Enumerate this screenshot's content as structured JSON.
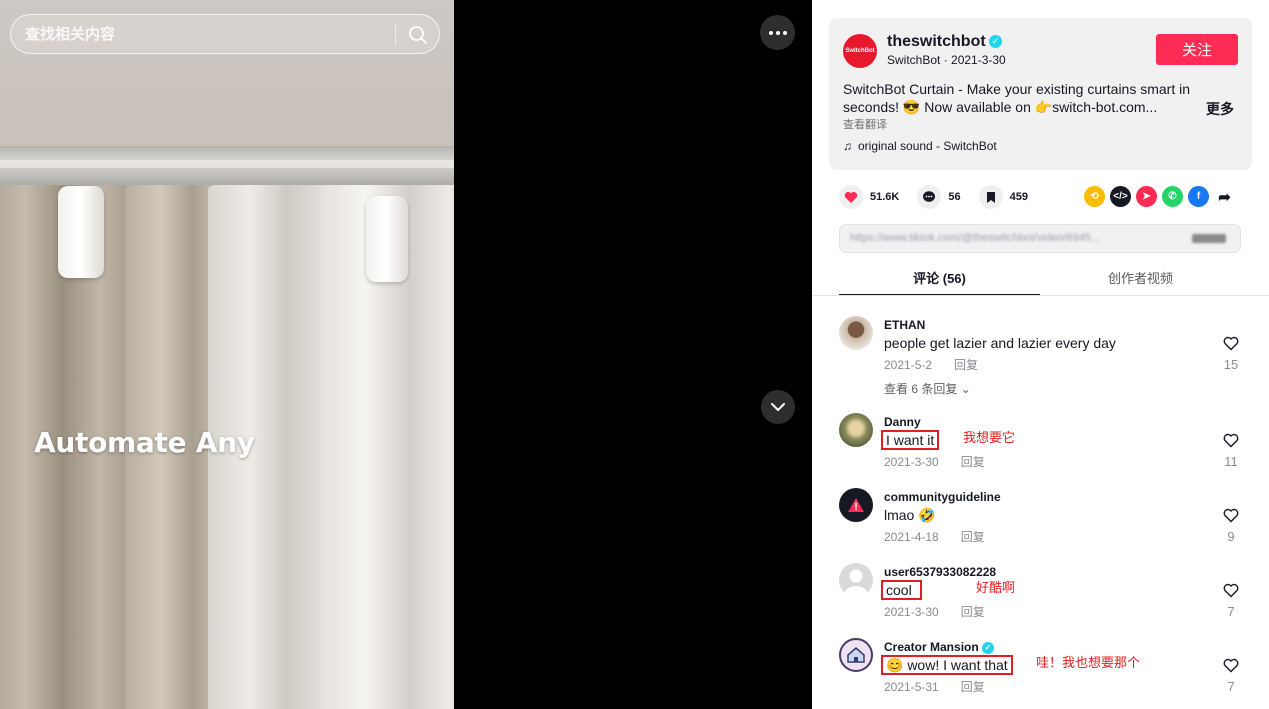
{
  "search": {
    "placeholder": "查找相关内容"
  },
  "video": {
    "overlay_text": "Automate Any"
  },
  "author": {
    "logo_text": "SwitchBot",
    "username": "theswitchbot",
    "nickname_date": "SwitchBot · 2021-3-30",
    "follow_label": "关注"
  },
  "description": {
    "text": "SwitchBot Curtain - Make your existing curtains smart in seconds! 😎 Now available on 👉switch-bot.com...",
    "more_label": "更多",
    "translate_label": "查看翻译",
    "sound": "original sound - SwitchBot"
  },
  "actions": {
    "likes": "51.6K",
    "comments": "56",
    "saves": "459"
  },
  "url_bar": {
    "text": "https://www.tiktok.com/@theswitchbot/video/6945..."
  },
  "tabs": {
    "comments": "评论 (56)",
    "creator_videos": "创作者视频"
  },
  "comments": [
    {
      "user": "ETHAN",
      "text": "people get lazier and lazier every day",
      "date": "2021-5-2",
      "reply": "回复",
      "likes": "15",
      "view_replies": "查看 6 条回复",
      "annotation": ""
    },
    {
      "user": "Danny",
      "text": "I want it",
      "date": "2021-3-30",
      "reply": "回复",
      "likes": "11",
      "annotation": "我想要它"
    },
    {
      "user": "communityguideline",
      "text": "lmao 🤣",
      "date": "2021-4-18",
      "reply": "回复",
      "likes": "9",
      "annotation": ""
    },
    {
      "user": "user6537933082228",
      "text": "cool",
      "date": "2021-3-30",
      "reply": "回复",
      "likes": "7",
      "annotation": "好酷啊"
    },
    {
      "user": "Creator Mansion",
      "text": "😊 wow! I want that",
      "date": "2021-5-31",
      "reply": "回复",
      "likes": "7",
      "annotation": "哇！我也想要那个"
    }
  ],
  "colors": {
    "follow": "#fe2c55",
    "annotation": "#e02020",
    "like": "#fe2c55"
  }
}
